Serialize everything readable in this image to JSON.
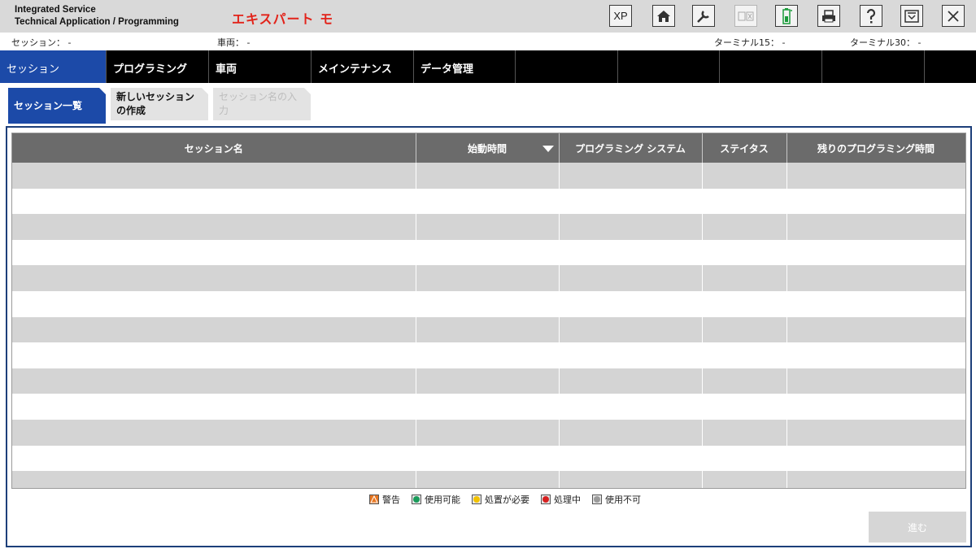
{
  "header": {
    "app_title_line1": "Integrated Service",
    "app_title_line2": "Technical Application / Programming",
    "mode_label": "エキスパート モ",
    "toolbar": {
      "xp_label": "XP"
    }
  },
  "info": {
    "session": "セッション：  -",
    "vehicle": "車両：  -",
    "terminal15": "ターミナル15：  -",
    "terminal30": "ターミナル30：  -"
  },
  "nav": {
    "tabs": [
      "セッション",
      "プログラミング",
      "車両",
      "メインテナンス",
      "データ管理",
      "",
      "",
      "",
      ""
    ]
  },
  "subtabs": {
    "list": "セッション一覧",
    "new_line1": "新しいセッション",
    "new_line2": "の作成",
    "name_line1": "セッション名の入",
    "name_line2": "力"
  },
  "table": {
    "headers": [
      "セッション名",
      "始動時間",
      "プログラミング システム",
      "ステイタス",
      "残りのプログラミング時間"
    ],
    "row_count": 13
  },
  "legend": [
    {
      "label": "警告",
      "color": "#e87722",
      "shape": "warning-icon"
    },
    {
      "label": "使用可能",
      "color": "#1a9b5a",
      "shape": "circle"
    },
    {
      "label": "処置が必要",
      "color": "#f2c200",
      "shape": "circle"
    },
    {
      "label": "処理中",
      "color": "#d62020",
      "shape": "circle"
    },
    {
      "label": "使用不可",
      "color": "#9a9a9a",
      "shape": "circle"
    }
  ],
  "footer": {
    "proceed_label": "進む"
  },
  "colors": {
    "accent": "#1c4aa8",
    "mode": "#e2231a",
    "battery": "#1a9b3a"
  }
}
